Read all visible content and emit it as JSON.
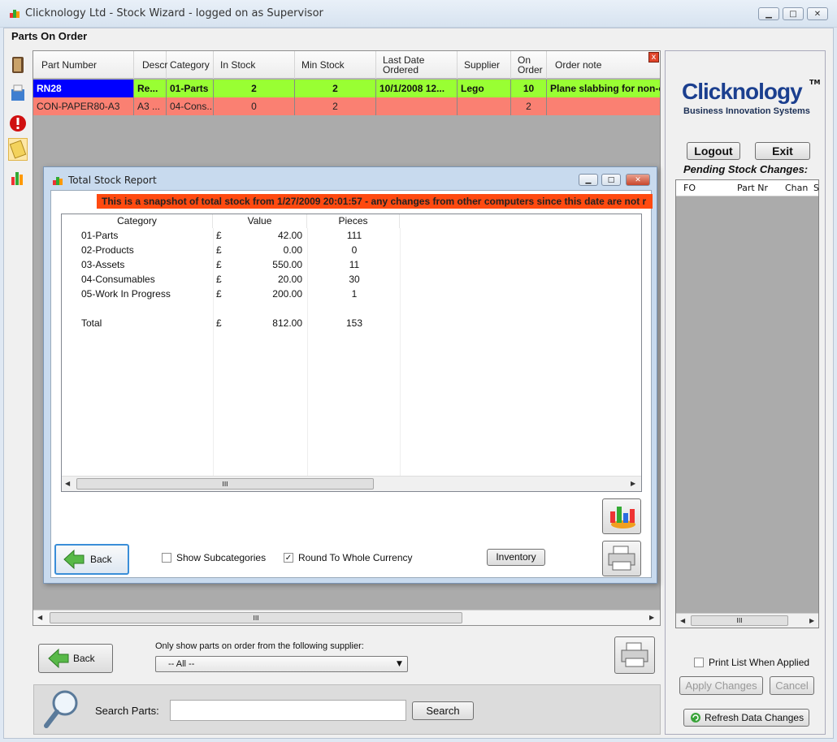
{
  "window": {
    "title": "Clicknology Ltd - Stock Wizard - logged on as Supervisor",
    "minimize": "▁",
    "maximize": "□",
    "close": "✕"
  },
  "page_title": "Parts On Order",
  "grid": {
    "columns": [
      "Part Number",
      "Descr",
      "Category",
      "In Stock",
      "Min Stock",
      "Last Date\nOrdered",
      "Supplier",
      "On\nOrder",
      "Order note"
    ],
    "rows": [
      {
        "part_number": "RN28",
        "descr": "Re...",
        "category": "01-Parts",
        "in_stock": "2",
        "min_stock": "2",
        "last_date": "10/1/2008 12...",
        "supplier": "Lego",
        "on_order": "10",
        "order_note": "Plane slabbing for non-co",
        "color": "#99ff33"
      },
      {
        "part_number": "CON-PAPER80-A3",
        "descr": "A3 ...",
        "category": "04-Cons...",
        "in_stock": "0",
        "min_stock": "2",
        "last_date": "",
        "supplier": "",
        "on_order": "2",
        "order_note": "",
        "color": "#fa8072"
      }
    ],
    "close_label": "x",
    "scroll_thumb": "III"
  },
  "dialog": {
    "title": "Total Stock Report",
    "banner": "This is a snapshot of total stock from 1/27/2009 20:01:57 - any changes from other computers since this date are not r",
    "columns": {
      "category": "Category",
      "value": "Value",
      "pieces": "Pieces"
    },
    "rows": [
      {
        "category": "01-Parts",
        "currency": "£",
        "value": "42.00",
        "pieces": "111"
      },
      {
        "category": "02-Products",
        "currency": "£",
        "value": "0.00",
        "pieces": "0"
      },
      {
        "category": "03-Assets",
        "currency": "£",
        "value": "550.00",
        "pieces": "11"
      },
      {
        "category": "04-Consumables",
        "currency": "£",
        "value": "20.00",
        "pieces": "30"
      },
      {
        "category": "05-Work In Progress",
        "currency": "£",
        "value": "200.00",
        "pieces": "1"
      }
    ],
    "total": {
      "category": "Total",
      "currency": "£",
      "value": "812.00",
      "pieces": "153"
    },
    "back_label": "Back",
    "show_subcategories": {
      "label": "Show Subcategories",
      "checked": false
    },
    "round_currency": {
      "label": "Round To Whole Currency",
      "checked": true,
      "mark": "✓"
    },
    "inventory_label": "Inventory",
    "scroll_thumb": "III"
  },
  "bottom": {
    "back_label": "Back",
    "supplier_prompt": "Only show parts on order from the following supplier:",
    "supplier_value": "-- All --",
    "search_label": "Search Parts:",
    "search_value": "",
    "search_button": "Search"
  },
  "right": {
    "brand": "Clicknology",
    "brand_tm": "TM",
    "tagline": "Business Innovation Systems",
    "logout": "Logout",
    "exit": "Exit",
    "pending_title": "Pending Stock Changes:",
    "pending_columns": [
      "FO",
      "Part Nr",
      "Chan",
      "S"
    ],
    "print_list": "Print List When Applied",
    "apply": "Apply Changes",
    "cancel": "Cancel",
    "refresh": "Refresh Data Changes",
    "scroll_thumb": "III"
  }
}
